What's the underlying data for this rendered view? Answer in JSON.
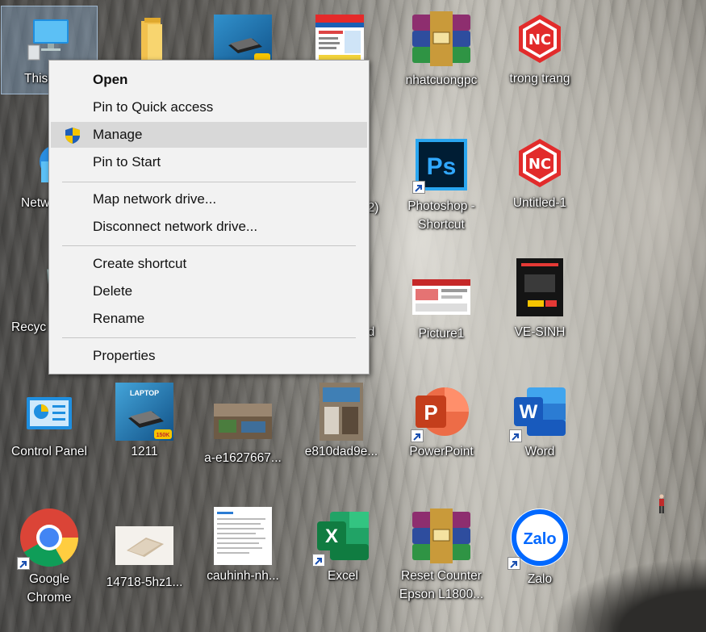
{
  "desktop": {
    "icons": [
      {
        "id": "this-pc",
        "label": "This",
        "type": "computer"
      },
      {
        "id": "folder",
        "label": "",
        "type": "folder"
      },
      {
        "id": "laptop-ad-top",
        "label": "",
        "type": "laptop-ad"
      },
      {
        "id": "doc-ad-top",
        "label": "",
        "type": "doc-ad"
      },
      {
        "id": "nhatcuongpc",
        "label": "nhatcuongpc",
        "type": "winrar"
      },
      {
        "id": "trong-trang",
        "label": "trong trang",
        "type": "nc-logo"
      },
      {
        "id": "network",
        "label": "Netw",
        "type": "network"
      },
      {
        "id": "hidden-2",
        "label": "(2)",
        "type": "hidden"
      },
      {
        "id": "photoshop",
        "label": "Photoshop - Shortcut",
        "type": "photoshop"
      },
      {
        "id": "untitled-1",
        "label": "Untitled-1",
        "type": "nc-logo"
      },
      {
        "id": "recycle",
        "label": "Recyc",
        "type": "recycle"
      },
      {
        "id": "hidden-d",
        "label": "d",
        "type": "hidden"
      },
      {
        "id": "picture1",
        "label": "Picture1",
        "type": "picture"
      },
      {
        "id": "ve-sinh",
        "label": "VE-SINH",
        "type": "dark-ad"
      },
      {
        "id": "control-panel",
        "label": "Control Panel",
        "type": "control-panel"
      },
      {
        "id": "1211",
        "label": "1211",
        "type": "laptop-ad"
      },
      {
        "id": "a-e1627667",
        "label": "a-e1627667...",
        "type": "photo-room"
      },
      {
        "id": "e810dad9e",
        "label": "e810dad9e...",
        "type": "photo-shop"
      },
      {
        "id": "powerpoint",
        "label": "PowerPoint",
        "type": "powerpoint"
      },
      {
        "id": "word",
        "label": "Word",
        "type": "word"
      },
      {
        "id": "google-chrome",
        "label": "Google Chrome",
        "type": "chrome"
      },
      {
        "id": "14718-5hz1",
        "label": "14718-5hz1...",
        "type": "laptop-photo"
      },
      {
        "id": "cauhinh-nh",
        "label": "cauhinh-nh...",
        "type": "screenshot"
      },
      {
        "id": "excel",
        "label": "Excel",
        "type": "excel"
      },
      {
        "id": "reset-counter",
        "label": "Reset Counter Epson L1800...",
        "type": "winrar"
      },
      {
        "id": "zalo",
        "label": "Zalo",
        "type": "zalo"
      }
    ]
  },
  "context_menu": {
    "items": [
      {
        "label": "Open",
        "bold": true
      },
      {
        "label": "Pin to Quick access"
      },
      {
        "label": "Manage",
        "icon": "shield-icon",
        "highlighted": true
      },
      {
        "label": "Pin to Start"
      },
      {
        "label": "Map network drive..."
      },
      {
        "label": "Disconnect network drive..."
      },
      {
        "label": "Create shortcut"
      },
      {
        "label": "Delete"
      },
      {
        "label": "Rename"
      },
      {
        "label": "Properties"
      }
    ]
  },
  "icon_texts": {
    "photoshop": "Ps",
    "word": "W",
    "excel": "X",
    "powerpoint": "P",
    "zalo": "Zalo",
    "nc": "NC",
    "ad_laptop": "LAPTOP",
    "ad_price": "150K"
  }
}
